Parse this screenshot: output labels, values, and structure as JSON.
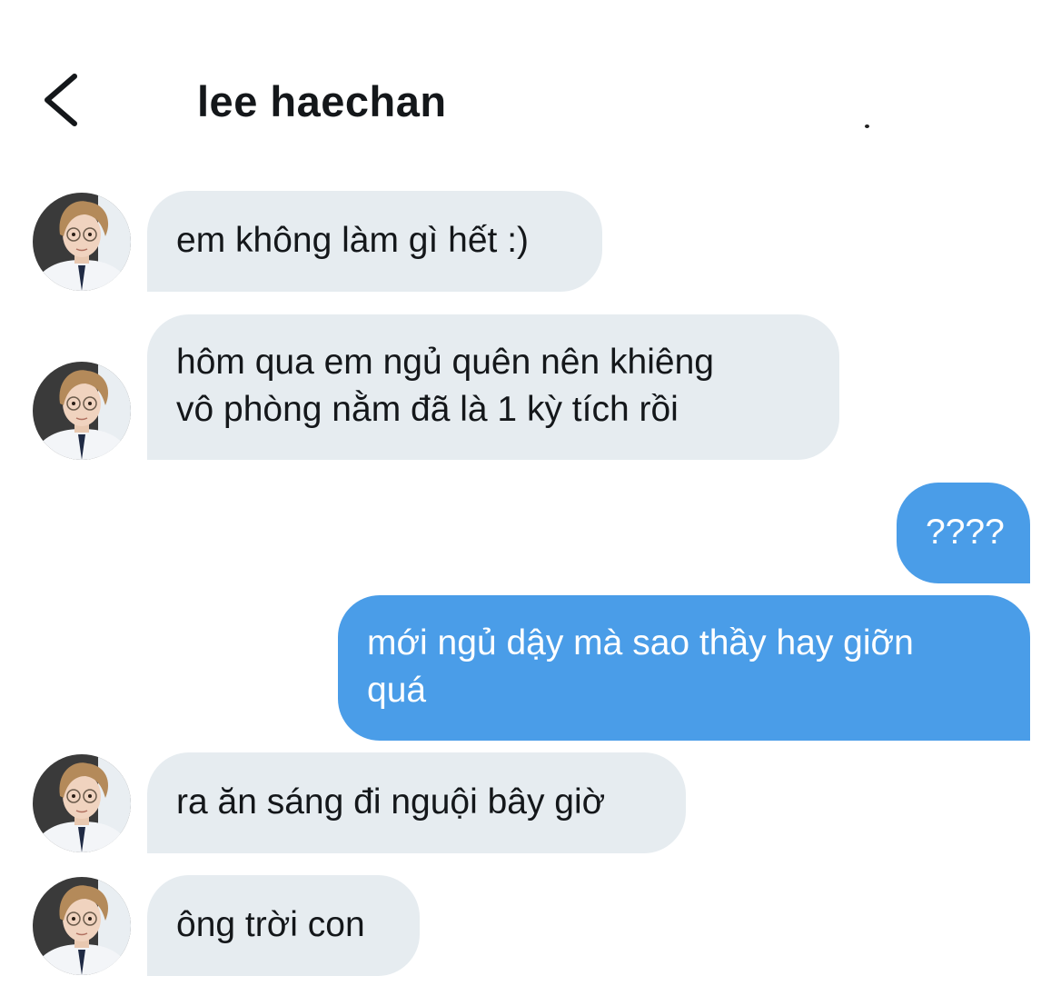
{
  "header": {
    "title": "lee haechan"
  },
  "messages": [
    {
      "direction": "in",
      "lines": [
        "em không làm gì hết :)"
      ]
    },
    {
      "direction": "in",
      "lines": [
        "hôm qua em ngủ quên nên khiêng",
        "vô phòng nằm đã là 1 kỳ tích rồi"
      ]
    },
    {
      "direction": "out",
      "lines": [
        "????"
      ]
    },
    {
      "direction": "out",
      "lines": [
        "mới ngủ dậy mà sao thầy hay giỡn",
        "quá"
      ]
    },
    {
      "direction": "in",
      "lines": [
        "ra ăn sáng đi nguội bây giờ"
      ]
    },
    {
      "direction": "in",
      "lines": [
        "ông trời con"
      ]
    }
  ],
  "colors": {
    "incoming_bubble": "#e6ecf0",
    "outgoing_bubble": "#4a9de8",
    "text_dark": "#14171a",
    "text_light": "#ffffff"
  },
  "icons": {
    "back": "chevron-left-icon",
    "avatar": "contact-avatar"
  }
}
